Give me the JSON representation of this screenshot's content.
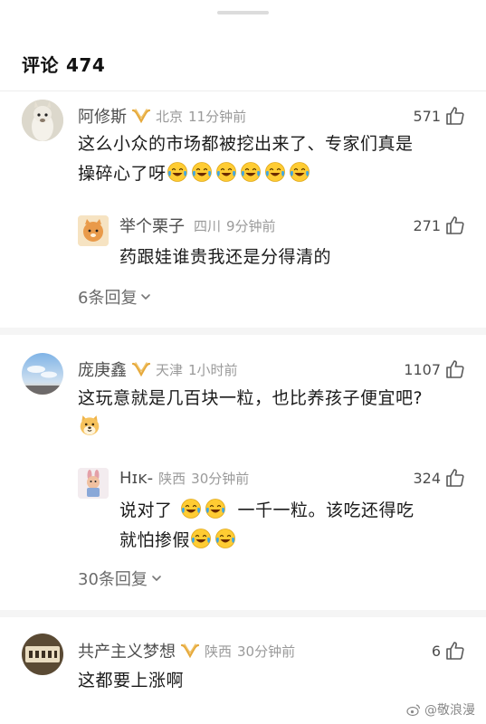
{
  "header": {
    "title": "评论",
    "count": "474"
  },
  "comments": [
    {
      "username": "阿修斯",
      "location": "北京",
      "time": "11分钟前",
      "likes": "571",
      "text_line1": "这么小众的市场都被挖出来了、专家们真是",
      "text_line2": "操碎心了呀",
      "emoji": "laugh-cry-emoji",
      "emoji_count": 6,
      "reply": {
        "username": "举个栗子",
        "location": "四川",
        "time": "9分钟前",
        "likes": "271",
        "text": "药跟娃谁贵我还是分得清的"
      },
      "more_replies": "6条回复"
    },
    {
      "username": "庞庚鑫",
      "location": "天津",
      "time": "1小时前",
      "likes": "1107",
      "text_line1": "这玩意就是几百块一粒，也比养孩子便宜吧?",
      "emoji": "doge-emoji",
      "reply": {
        "username": "Hɪᴋ-",
        "location": "陕西",
        "time": "30分钟前",
        "likes": "324",
        "text_part1": "说对了",
        "text_part2": "一千一粒。该吃还得吃",
        "text_line2": "就怕掺假"
      },
      "more_replies": "30条回复"
    },
    {
      "username": "共产主义梦想",
      "location": "陕西",
      "time": "30分钟前",
      "likes": "6",
      "text_line1": "这都要上涨啊"
    }
  ],
  "watermark": "@敬浪漫",
  "icons": {
    "vip_badge": "vip-badge-icon",
    "like": "thumbs-up-icon",
    "chevron": "chevron-down-icon",
    "weibo": "weibo-icon"
  },
  "colors": {
    "vip_gold": "#e6a93b",
    "meta_gray": "#9a9a9a",
    "emoji_yellow": "#ffcc33",
    "tear_blue": "#3ba6e8"
  }
}
